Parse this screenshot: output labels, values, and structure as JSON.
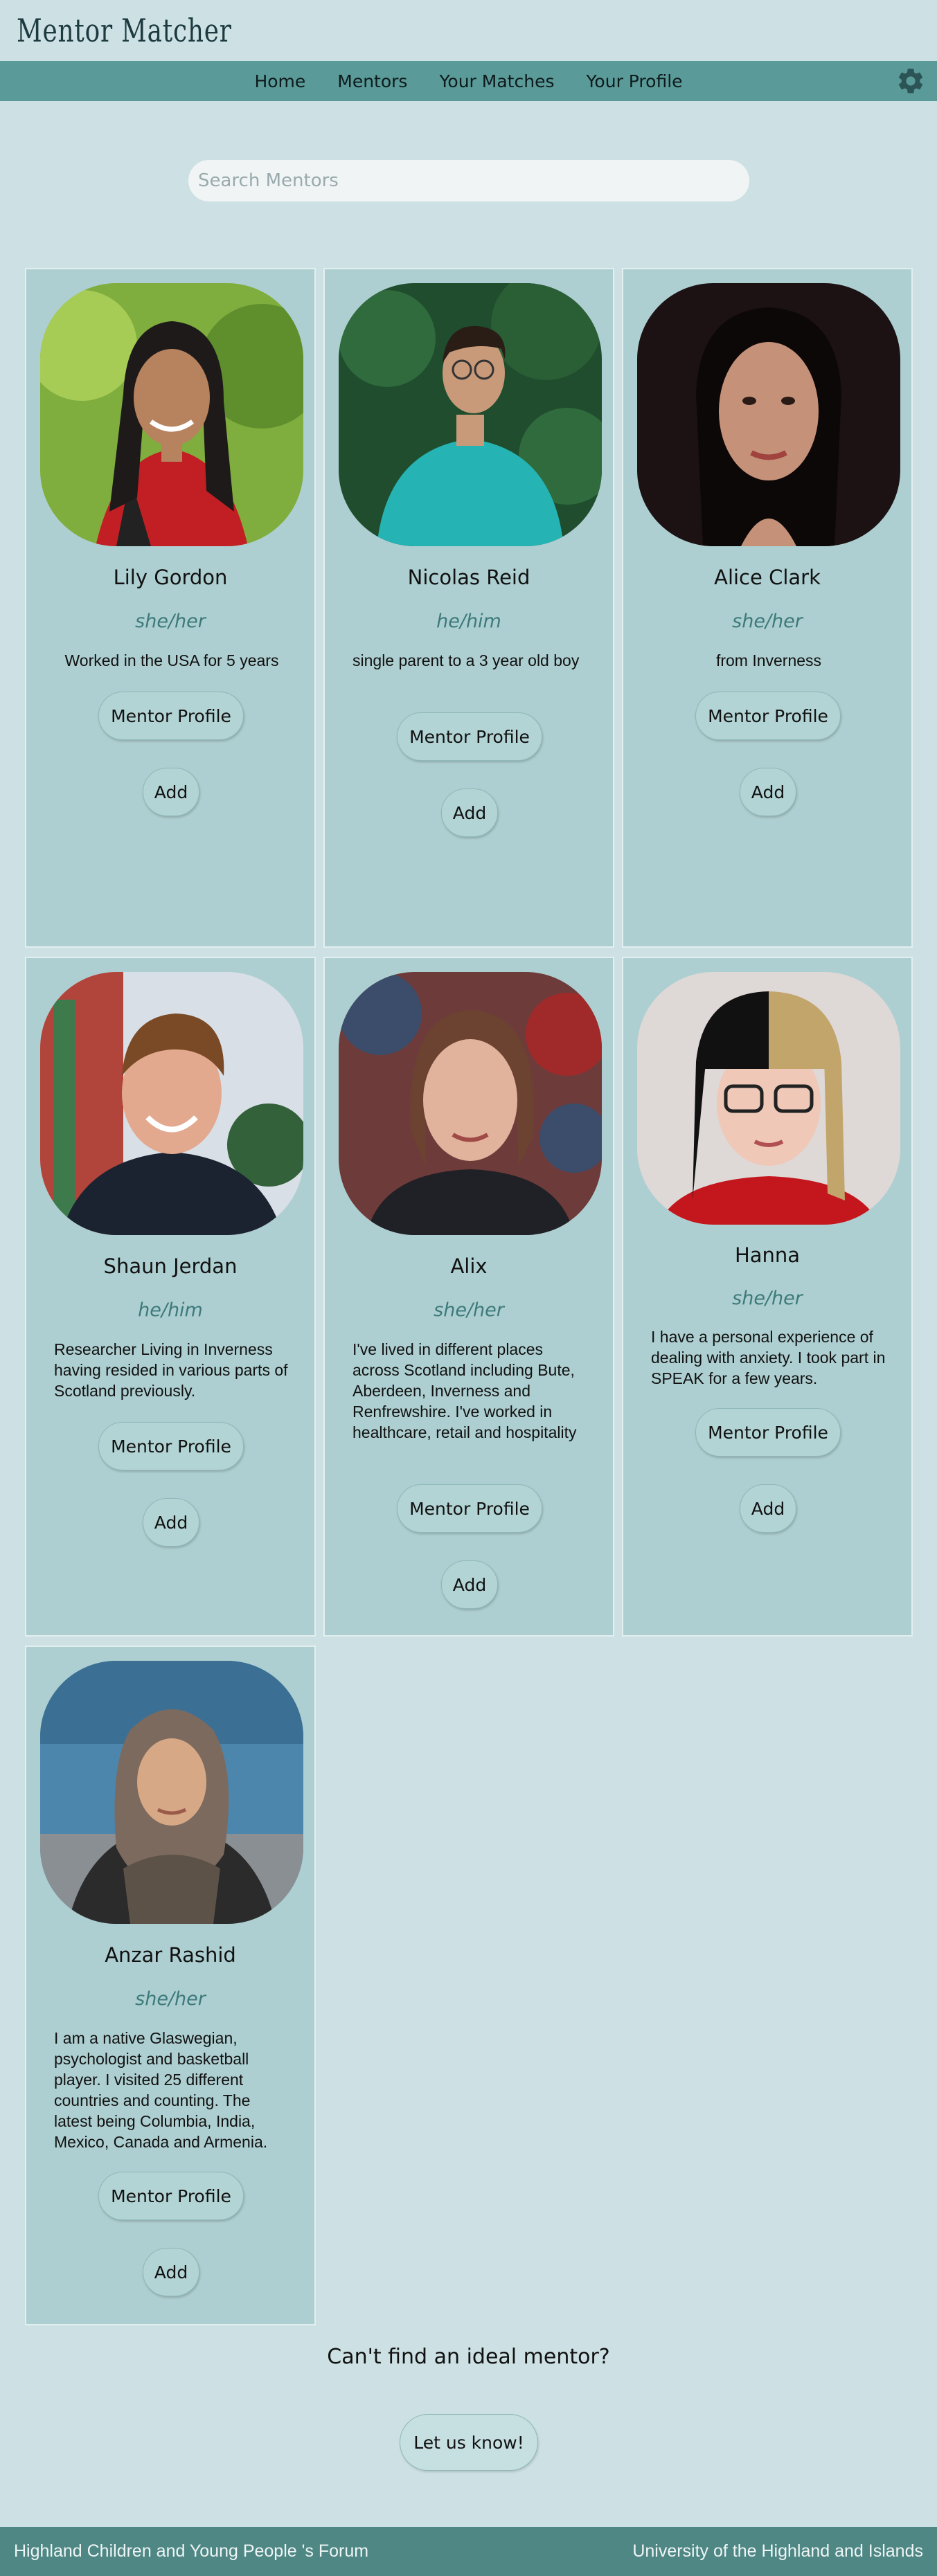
{
  "app": {
    "title": "Mentor Matcher"
  },
  "nav": {
    "items": [
      "Home",
      "Mentors",
      "Your Matches",
      "Your Profile"
    ],
    "settings_icon": "gear-icon"
  },
  "search": {
    "placeholder": "Search Mentors",
    "value": ""
  },
  "buttons": {
    "profile_label": "Mentor Profile",
    "add_label": "Add"
  },
  "mentors": [
    {
      "name": "Lily Gordon",
      "pronouns": "she/her",
      "bio": "Worked in the USA for 5 years"
    },
    {
      "name": "Nicolas Reid",
      "pronouns": "he/him",
      "bio": "single parent to a 3 year old boy"
    },
    {
      "name": "Alice Clark",
      "pronouns": "she/her",
      "bio": "from Inverness"
    },
    {
      "name": "Shaun Jerdan",
      "pronouns": "he/him",
      "bio": "Researcher Living in Inverness having resided in various parts of Scotland previously."
    },
    {
      "name": "Alix",
      "pronouns": "she/her",
      "bio": "I've lived in different places across Scotland including Bute, Aberdeen, Inverness and Renfrewshire. I've worked in healthcare, retail and hospitality"
    },
    {
      "name": "Hanna",
      "pronouns": "she/her",
      "bio": "I have a personal experience of dealing with anxiety. I took part in SPEAK for a few years."
    },
    {
      "name": "Anzar Rashid",
      "pronouns": "she/her",
      "bio": "I am a native Glaswegian, psychologist and basketball player. I visited 25 different countries and counting. The latest being Columbia, India, Mexico, Canada and Armenia."
    }
  ],
  "cta": {
    "text": "Can't find an ideal mentor?",
    "button": "Let us know!"
  },
  "footer": {
    "left": "Highland Children and Young People 's Forum",
    "right": "University of the Highland and Islands"
  }
}
